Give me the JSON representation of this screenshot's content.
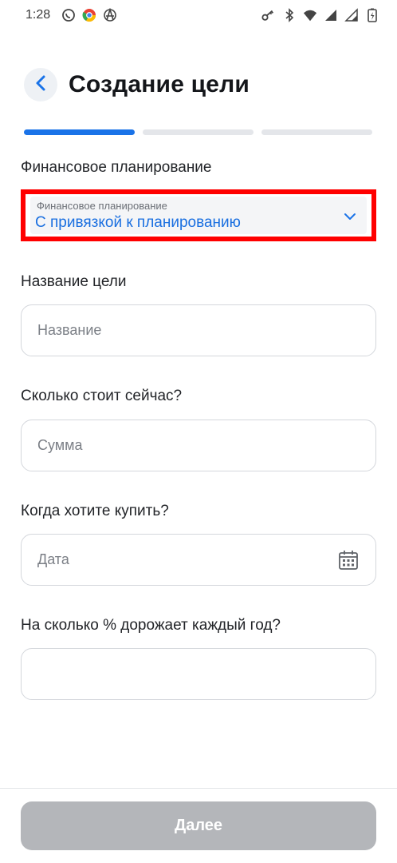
{
  "status_bar": {
    "time": "1:28",
    "left_icons": [
      "whatsapp-icon",
      "chrome-icon",
      "anarchy-icon"
    ],
    "right_icons": [
      "vpn-key-icon",
      "bluetooth-icon",
      "wifi-icon",
      "signal-icon",
      "signal-icon",
      "battery-charging-icon"
    ]
  },
  "header": {
    "title": "Создание цели",
    "back_icon": "chevron-left-icon"
  },
  "progress": {
    "total_steps": 3,
    "current_step": 1
  },
  "planning": {
    "section_label": "Финансовое планирование",
    "dropdown_caption": "Финансовое планирование",
    "dropdown_value": "С привязкой к планированию"
  },
  "goal_name": {
    "label": "Название цели",
    "placeholder": "Название",
    "value": ""
  },
  "cost_now": {
    "label": "Сколько стоит сейчас?",
    "placeholder": "Сумма",
    "value": ""
  },
  "buy_date": {
    "label": "Когда хотите купить?",
    "placeholder": "Дата",
    "value": "",
    "icon": "calendar-icon"
  },
  "inflation": {
    "label": "На сколько % дорожает каждый год?",
    "placeholder": "",
    "value": ""
  },
  "footer": {
    "next_label": "Далее"
  },
  "colors": {
    "accent": "#1a73e8",
    "highlight": "#ff0000",
    "disabled_button": "#b4b6ba"
  }
}
